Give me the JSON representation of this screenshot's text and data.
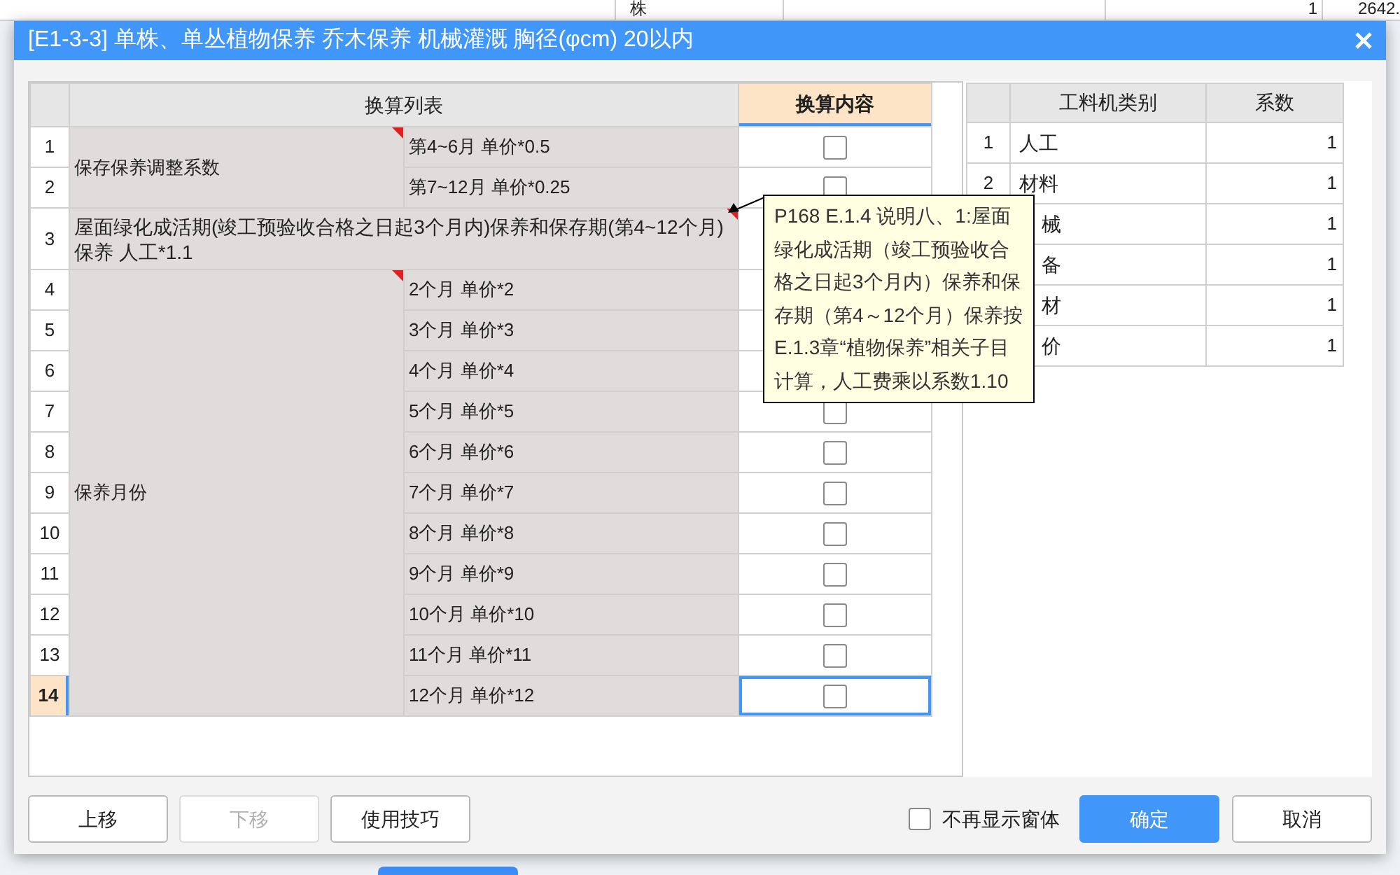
{
  "background": {
    "cells": [
      "株",
      "1",
      "2642."
    ]
  },
  "dialog": {
    "title": "[E1-3-3] 单株、单丛植物保养 乔木保养 机械灌溉 胸径(φcm) 20以内"
  },
  "conversion_table": {
    "columns": [
      {
        "label": "换算列表",
        "selected": false
      },
      {
        "label": "换算内容",
        "selected": true
      }
    ],
    "groups": [
      {
        "name": "保存保养调整系数",
        "has_note": true,
        "rows": [
          {
            "number": "1",
            "text": "第4~6月 单价*0.5",
            "checked": false,
            "selected": false
          },
          {
            "number": "2",
            "text": "第7~12月 单价*0.25",
            "checked": false,
            "selected": false
          }
        ]
      },
      {
        "name": "屋面绿化成活期(竣工预验收合格之日起3个月内)保养和保存期(第4~12个月)保养 人工*1.1",
        "has_note": true,
        "rows": [
          {
            "number": "3",
            "selected": false
          }
        ]
      },
      {
        "name": "保养月份",
        "has_note": true,
        "rows": [
          {
            "number": "4",
            "text": "2个月 单价*2",
            "selected": false
          },
          {
            "number": "5",
            "text": "3个月 单价*3",
            "selected": false
          },
          {
            "number": "6",
            "text": "4个月 单价*4",
            "selected": false
          },
          {
            "number": "7",
            "text": "5个月 单价*5",
            "checked": false,
            "selected": false
          },
          {
            "number": "8",
            "text": "6个月 单价*6",
            "checked": false,
            "selected": false
          },
          {
            "number": "9",
            "text": "7个月 单价*7",
            "checked": false,
            "selected": false
          },
          {
            "number": "10",
            "text": "8个月 单价*8",
            "checked": false,
            "selected": false
          },
          {
            "number": "11",
            "text": "9个月 单价*9",
            "checked": false,
            "selected": false
          },
          {
            "number": "12",
            "text": "10个月 单价*10",
            "checked": false,
            "selected": false
          },
          {
            "number": "13",
            "text": "11个月 单价*11",
            "checked": false,
            "selected": false
          },
          {
            "number": "14",
            "text": "12个月 单价*12",
            "checked": false,
            "selected": true
          }
        ]
      }
    ]
  },
  "tooltip": {
    "text": "P168 E.1.4 说明八、1:屋面绿化成活期（竣工预验收合格之日起3个月内）保养和保存期（第4～12个月）保养按E.1.3章“植物保养”相关子目计算，人工费乘以系数1.10"
  },
  "coefficient_table": {
    "columns": [
      "工料机类别",
      "系数"
    ],
    "rows": [
      {
        "number": "1",
        "category": "人工",
        "value": "1"
      },
      {
        "number": "2",
        "category": "材料",
        "value": "1"
      },
      {
        "category": "械",
        "value": "1"
      },
      {
        "category": "备",
        "value": "1"
      },
      {
        "category": "材",
        "value": "1"
      },
      {
        "category": "价",
        "value": "1"
      }
    ]
  },
  "buttons": [
    {
      "label": "上移",
      "disabled": false
    },
    {
      "label": "下移",
      "disabled": true
    },
    {
      "label": "使用技巧",
      "disabled": false
    }
  ],
  "dont_show_again": {
    "label": "不再显示窗体",
    "checked": false
  },
  "actions": [
    {
      "label": "确定",
      "kind": "primary"
    },
    {
      "label": "取消",
      "kind": "secondary"
    }
  ]
}
